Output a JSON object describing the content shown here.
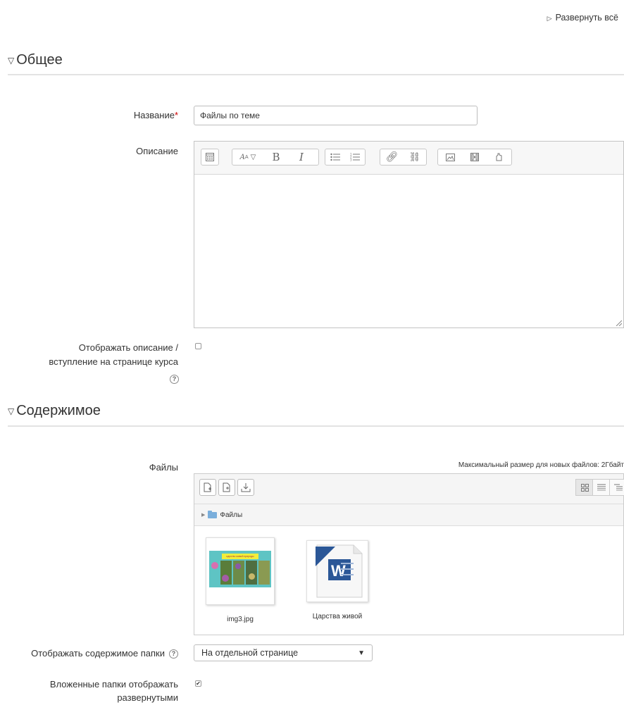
{
  "expand_all": "Развернуть всё",
  "sections": {
    "general": "Общее",
    "content": "Содержимое"
  },
  "fields": {
    "name_label": "Название",
    "name_required": "*",
    "name_value": "Файлы по теме",
    "description_label": "Описание",
    "show_description_label_1": "Отображать описание /",
    "show_description_label_2": "вступление на странице курса",
    "files_label": "Файлы",
    "max_size": "Максимальный размер для новых файлов: 2Гбайт",
    "display_label": "Отображать содержимое папки",
    "display_value": "На отдельной странице",
    "subfolders_label_1": "Вложенные папки отображать",
    "subfolders_label_2": "развернутыми"
  },
  "checkboxes": {
    "show_description": false,
    "subfolders_expanded": true
  },
  "editor_toolbar": [
    "toolbar-toggle",
    "font-style",
    "bold",
    "italic",
    "unordered-list",
    "ordered-list",
    "link",
    "unlink",
    "image",
    "media",
    "manage-files"
  ],
  "filemanager": {
    "path_folder": "Файлы",
    "files": [
      {
        "name": "img3.jpg",
        "type": "image",
        "caption": "царство живой природы"
      },
      {
        "name": "Царства живой",
        "type": "word"
      }
    ]
  },
  "colors": {
    "required": "#cc0000",
    "folder": "#7aaedb",
    "word_blue": "#2b5797"
  }
}
